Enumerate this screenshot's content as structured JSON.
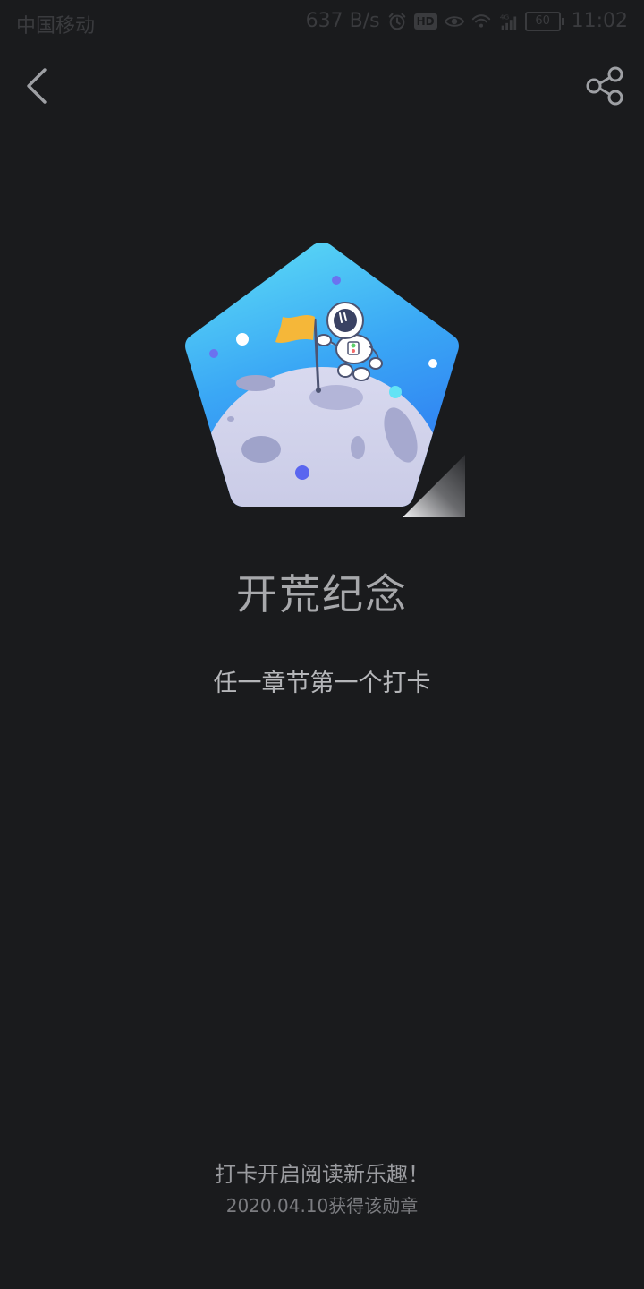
{
  "status_bar": {
    "carrier": "中国移动",
    "net_speed": "637 B/s",
    "hd_label": "HD",
    "network_type": "4G",
    "battery": "60",
    "time": "11:02",
    "icons": [
      "alarm-icon",
      "eye-icon",
      "wifi-icon",
      "signal-icon",
      "battery-icon"
    ]
  },
  "nav": {
    "back_icon": "chevron-left-icon",
    "share_icon": "share-icon"
  },
  "badge": {
    "image_subject": "astronaut planting a flag on the moon",
    "title": "开荒纪念",
    "description": "任一章节第一个打卡"
  },
  "footer": {
    "slogan": "打卡开启阅读新乐趣！",
    "earned_date": "2020.04.10获得该勋章"
  },
  "colors": {
    "background": "#1a1b1d",
    "title": "#a7a8ab",
    "badge_gradient_top": "#5fe0f5",
    "badge_gradient_bottom": "#2f7ef2",
    "moon": "#c9cbe6",
    "flag": "#f5b739"
  }
}
